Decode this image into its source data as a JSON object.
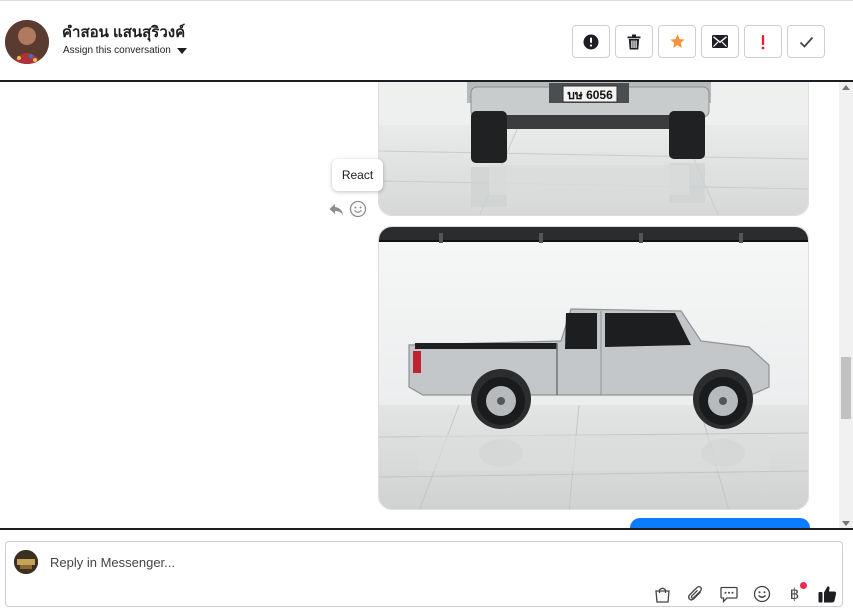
{
  "header": {
    "user_name": "คำสอน แสนสุริวงค์",
    "assign_label": "Assign this conversation",
    "actions": [
      {
        "name": "mark-spam-button",
        "icon": "alert-circle-icon"
      },
      {
        "name": "delete-button",
        "icon": "trash-icon"
      },
      {
        "name": "star-button",
        "icon": "star-icon",
        "color": "#f7923a"
      },
      {
        "name": "mark-unread-button",
        "icon": "envelope-icon"
      },
      {
        "name": "follow-up-button",
        "icon": "exclamation-icon",
        "color": "#e41e3f"
      },
      {
        "name": "mark-done-button",
        "icon": "checkmark-icon"
      }
    ]
  },
  "thread": {
    "tooltip": "React",
    "plate_text": "บษ 6056",
    "bubble_color": "#0a7cff"
  },
  "composer": {
    "placeholder": "Reply in Messenger...",
    "tools": [
      "shopping-bag-icon",
      "paperclip-icon",
      "chat-bubble-icon",
      "emoji-icon",
      "baht-icon",
      "thumbs-up-icon"
    ],
    "baht_symbol": "฿",
    "notification_color": "#f02849"
  }
}
